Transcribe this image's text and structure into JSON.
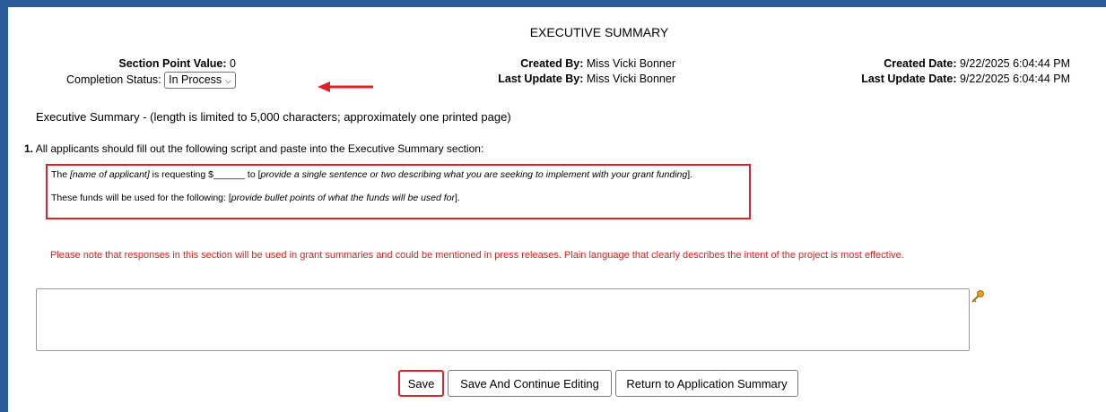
{
  "title": "EXECUTIVE SUMMARY",
  "section_point_value_label": "Section Point Value:",
  "section_point_value": "0",
  "completion_status_label": "Completion Status:",
  "completion_status_value": "In Process",
  "created_by_label": "Created By:",
  "created_by": "Miss Vicki Bonner",
  "last_update_by_label": "Last Update By:",
  "last_update_by": "Miss Vicki Bonner",
  "created_date_label": "Created Date:",
  "created_date": "9/22/2025 6:04:44 PM",
  "last_update_date_label": "Last Update Date:",
  "last_update_date": "9/22/2025 6:04:44 PM",
  "section_description": "Executive Summary - (length is limited to 5,000 characters; approximately one printed page)",
  "instruction_number": "1.",
  "instruction_text": "All applicants should fill out the following script and paste into the Executive Summary section:",
  "script_line1": {
    "a": "The ",
    "b": "[name of applicant]",
    "c": " is requesting $______ to [",
    "d": "provide a single sentence or two describing what you are seeking to implement with your grant funding",
    "e": "]."
  },
  "script_line2": {
    "a": "These funds will be used for the following: [",
    "b": "provide bullet points of what the funds will be used for",
    "c": "]."
  },
  "note": "Please note that responses in this section will be used in grant summaries and could be mentioned in press releases.  Plain language that clearly describes the intent of the project is most effective.",
  "textarea_value": "",
  "buttons": {
    "save": "Save",
    "save_continue": "Save And Continue Editing",
    "return": "Return to Application Summary"
  },
  "colors": {
    "frame": "#2b5d9c",
    "highlight": "#d9232a",
    "note": "#e0201b"
  },
  "icons": [
    "arrow-left-icon",
    "key-icon",
    "resize-grip-icon",
    "chevron-down-icon"
  ]
}
